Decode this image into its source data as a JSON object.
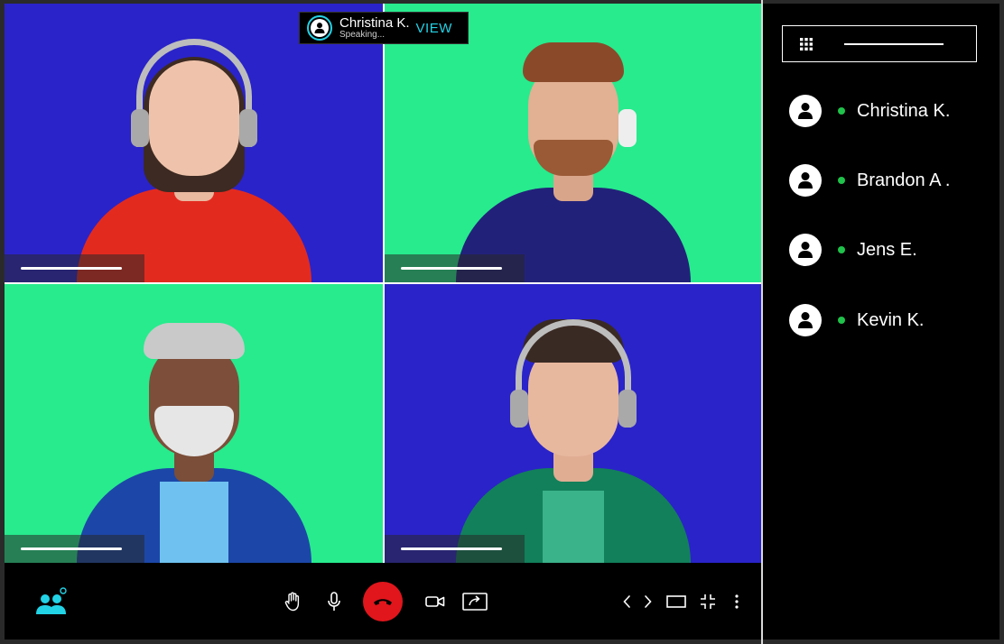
{
  "speaking_popup": {
    "name": "Christina K.",
    "status": "Speaking...",
    "view_label": "VIEW"
  },
  "participants": [
    {
      "name": "Christina K.",
      "online": true
    },
    {
      "name": "Brandon A .",
      "online": true
    },
    {
      "name": "Jens E.",
      "online": true
    },
    {
      "name": "Kevin K.",
      "online": true
    }
  ],
  "colors": {
    "tile_blue": "#2a23c9",
    "tile_green": "#27eb8d",
    "accent_cyan": "#22d3e6",
    "hangup_red": "#e0161c",
    "online_green": "#1fc24a"
  },
  "icons": {
    "participants": "people-icon",
    "raise_hand": "hand-icon",
    "microphone": "microphone-icon",
    "hangup": "phone-hangup-icon",
    "camera": "video-camera-icon",
    "share": "share-screen-icon",
    "layout_prev_next": "chevrons-icon",
    "fullscreen": "rectangle-icon",
    "shrink": "collapse-icon",
    "more": "more-vertical-icon",
    "grid": "grid-icon"
  }
}
